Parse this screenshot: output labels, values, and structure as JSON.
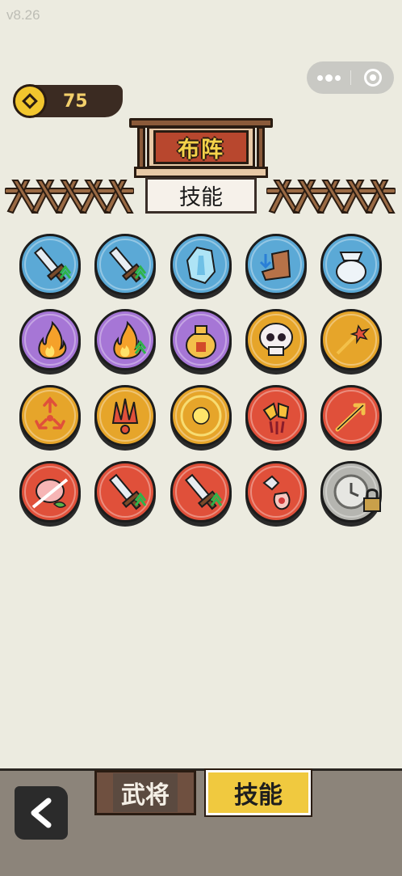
{
  "version": "v8.26",
  "currency": {
    "icon": "coin-icon",
    "amount": "75",
    "color": "#f2c62e"
  },
  "header": {
    "sign_label": "布阵",
    "tab_label": "技能"
  },
  "skills": [
    {
      "name": "sword-upgrade-icon",
      "color": "#5ba9d6",
      "locked": false
    },
    {
      "name": "purple-sword-speed-icon",
      "color": "#5ba9d6",
      "locked": false
    },
    {
      "name": "ice-crystal-icon",
      "color": "#5ba9d6",
      "locked": false
    },
    {
      "name": "boot-down-icon",
      "color": "#5ba9d6",
      "locked": false
    },
    {
      "name": "treasure-bag-icon",
      "color": "#5ba9d6",
      "locked": false
    },
    {
      "name": "fire-icon",
      "color": "#a676d6",
      "locked": false
    },
    {
      "name": "fire-upgrade-icon",
      "color": "#a676d6",
      "locked": false
    },
    {
      "name": "money-bag-icon",
      "color": "#a676d6",
      "locked": false
    },
    {
      "name": "skull-icon",
      "color": "#e6a52a",
      "locked": false
    },
    {
      "name": "arrow-explode-icon",
      "color": "#e6a52a",
      "locked": false
    },
    {
      "name": "triple-arrow-icon",
      "color": "#e6a52a",
      "locked": false
    },
    {
      "name": "claw-burst-icon",
      "color": "#e6a52a",
      "locked": false
    },
    {
      "name": "sun-compass-icon",
      "color": "#e6a52a",
      "locked": false
    },
    {
      "name": "crystal-claw-icon",
      "color": "#e0503a",
      "locked": false
    },
    {
      "name": "double-arrow-icon",
      "color": "#e0503a",
      "locked": false
    },
    {
      "name": "slash-peach-icon",
      "color": "#e0503a",
      "locked": false
    },
    {
      "name": "sword-upgrade-red-icon",
      "color": "#e0503a",
      "locked": false
    },
    {
      "name": "purple-sword-red-icon",
      "color": "#e0503a",
      "locked": false
    },
    {
      "name": "poison-bottle-icon",
      "color": "#e0503a",
      "locked": false
    },
    {
      "name": "cooldown-clock-icon",
      "color": "#b5b5b0",
      "locked": true
    }
  ],
  "bottom_nav": {
    "back_icon": "chevron-left-icon",
    "tab_general": "武将",
    "tab_skills": "技能",
    "active": "技能"
  }
}
